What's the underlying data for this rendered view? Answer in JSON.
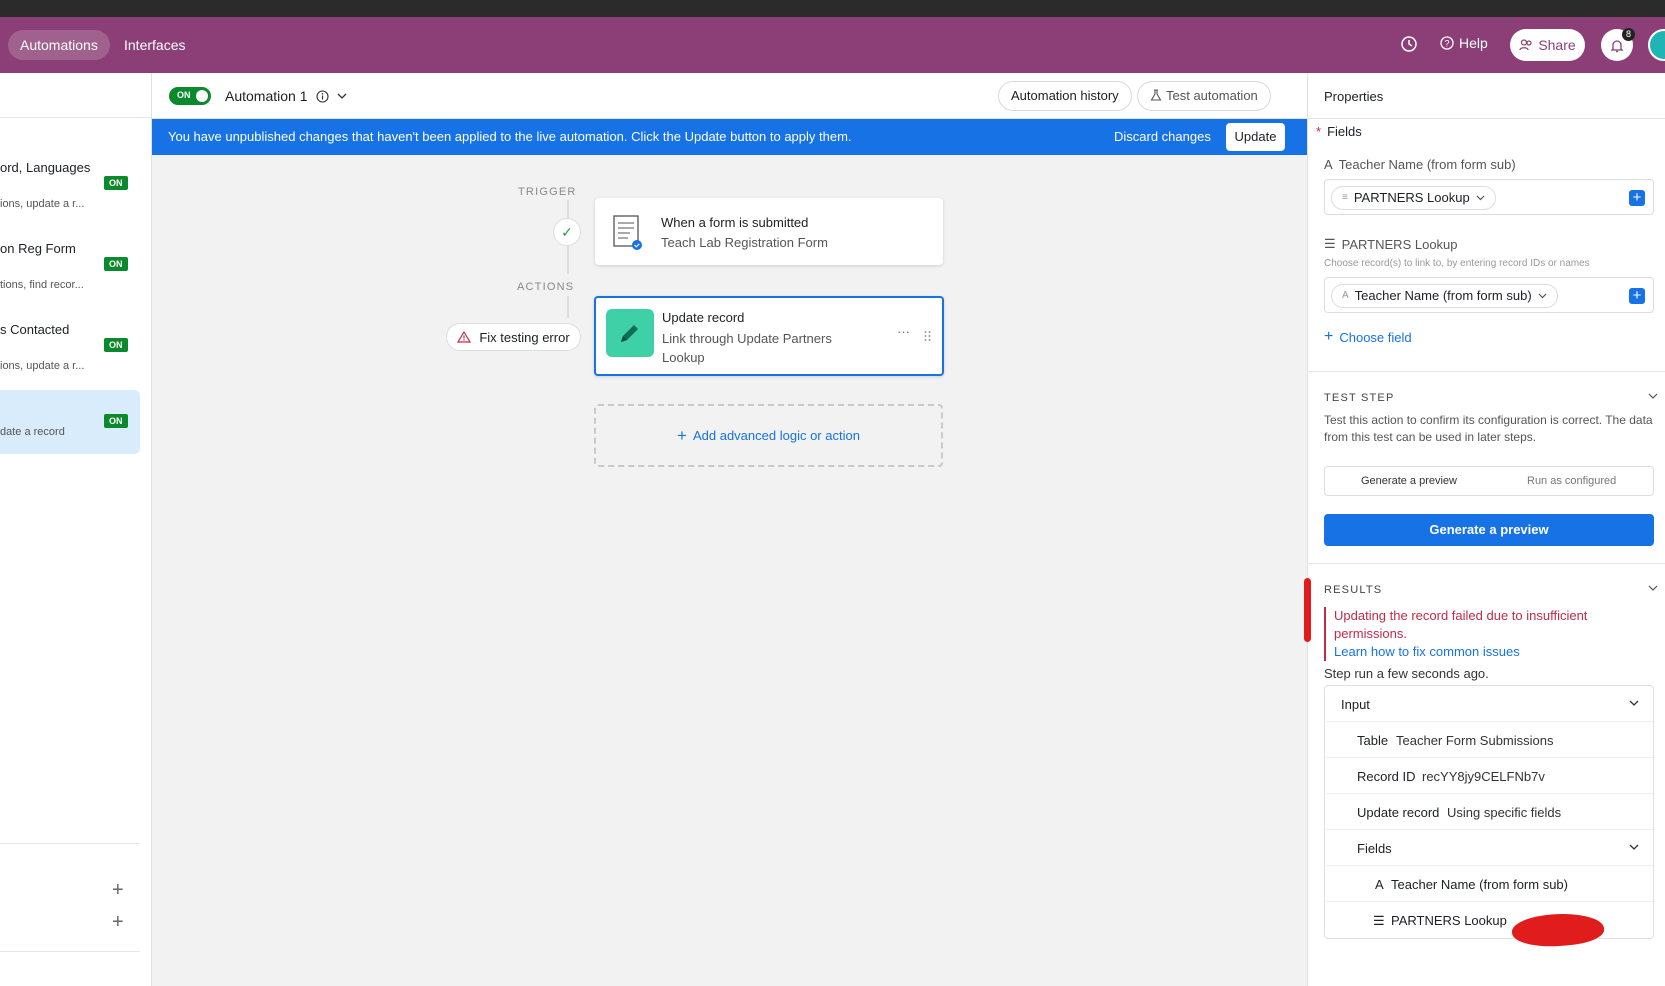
{
  "topbar": {
    "nav": [
      "Automations",
      "Interfaces"
    ],
    "help": "Help",
    "share": "Share",
    "bell_count": "8"
  },
  "sidebar": {
    "items": [
      {
        "title": "ord, Languages",
        "sub": "ions, update a r...",
        "badge": "ON"
      },
      {
        "title": "on Reg Form",
        "sub": "tions, find recor...",
        "badge": "ON"
      },
      {
        "title": "s Contacted",
        "sub": "ions, update a r...",
        "badge": "ON"
      },
      {
        "title": "",
        "sub": "date a record",
        "badge": "ON"
      }
    ]
  },
  "header": {
    "toggle": "ON",
    "automation_name": "Automation 1",
    "history_btn": "Automation history",
    "test_btn": "Test automation"
  },
  "banner": {
    "message": "You have unpublished changes that haven't been applied to the live automation. Click the Update button to apply them.",
    "discard": "Discard changes",
    "update": "Update"
  },
  "flow": {
    "trigger_label": "TRIGGER",
    "actions_label": "ACTIONS",
    "trigger": {
      "title": "When a form is submitted",
      "sub": "Teach Lab Registration Form"
    },
    "action": {
      "title": "Update record",
      "sub1": "Link through Update Partners",
      "sub2": "Lookup",
      "more": "···"
    },
    "fix": "Fix testing error",
    "add": "Add advanced logic or action"
  },
  "properties": {
    "title": "Properties",
    "fields_label": "Fields",
    "field1_label": "Teacher Name (from form sub)",
    "field1_token": "PARTNERS Lookup",
    "field2_label": "PARTNERS Lookup",
    "field2_hint": "Choose record(s) to link to, by entering record IDs or names",
    "field2_token": "Teacher Name (from form sub)",
    "choose_field": "Choose field",
    "test_step": {
      "title": "TEST STEP",
      "desc": "Test this action to confirm its configuration is correct. The data from this test can be used in later steps.",
      "tab1": "Generate a preview",
      "tab2": "Run as configured",
      "button": "Generate a preview"
    },
    "results": {
      "title": "RESULTS",
      "error": "Updating the record failed due to insufficient permissions.",
      "link": "Learn how to fix common issues",
      "step_run": "Step run a few seconds ago."
    },
    "input": {
      "label": "Input",
      "table_k": "Table",
      "table_v": "Teacher Form Submissions",
      "record_k": "Record ID",
      "record_v": "recYY8jy9CELFNb7v",
      "update_k": "Update record",
      "update_v": "Using specific fields",
      "fields_k": "Fields",
      "f1": "Teacher Name (from form sub)",
      "f2": "PARTNERS Lookup"
    }
  },
  "colors": {
    "topbar": "#8b3f76",
    "accent": "#1672e5",
    "on_badge": "#0b8a2d",
    "error": "#c12a4a"
  }
}
